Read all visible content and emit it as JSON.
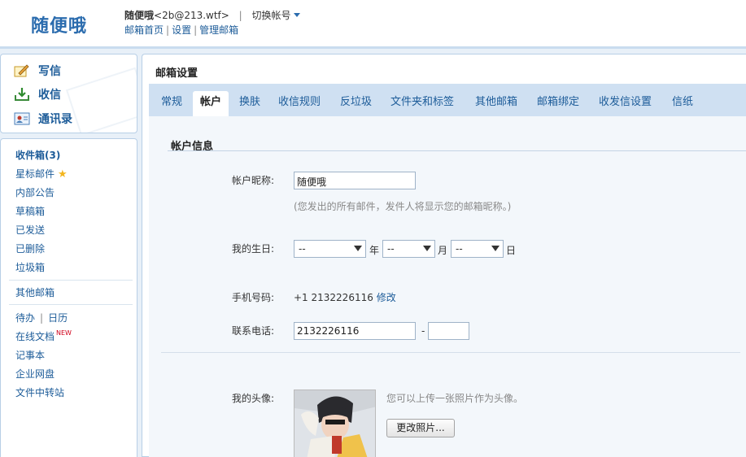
{
  "header": {
    "logo": "随便哦",
    "nickname": "随便哦",
    "email": "<2b@213.wtf>",
    "separator": "|",
    "switch_account": "切换帐号",
    "links": [
      "邮箱首页",
      "设置",
      "管理邮箱"
    ],
    "link_sep": "|"
  },
  "quick_actions": {
    "compose": "写信",
    "receive": "收信",
    "contacts": "通讯录"
  },
  "folders": {
    "inbox": "收件箱(3)",
    "starred": "星标邮件",
    "announcements": "内部公告",
    "drafts": "草稿箱",
    "sent": "已发送",
    "deleted": "已删除",
    "spam": "垃圾箱",
    "other_mailboxes": "其他邮箱",
    "todo": "待办",
    "todo_sep": "|",
    "calendar": "日历",
    "online_docs": "在线文档",
    "new_badge": "NEW",
    "notes": "记事本",
    "netdisk": "企业网盘",
    "file_transfer": "文件中转站"
  },
  "main": {
    "title": "邮箱设置",
    "tabs": [
      "常规",
      "帐户",
      "换肤",
      "收信规则",
      "反垃圾",
      "文件夹和标签",
      "其他邮箱",
      "邮箱绑定",
      "收发信设置",
      "信纸"
    ],
    "active_tab": "帐户"
  },
  "account": {
    "section_title": "帐户信息",
    "nickname_label": "帐户昵称:",
    "nickname_value": "随便哦",
    "nickname_hint": "(您发出的所有邮件，发件人将显示您的邮箱昵称。)",
    "birthday_label": "我的生日:",
    "birthday_year": "--",
    "year_unit": "年",
    "birthday_month": "--",
    "month_unit": "月",
    "birthday_day": "--",
    "day_unit": "日",
    "mobile_label": "手机号码:",
    "mobile_value": "+1 2132226116",
    "mobile_edit": "修改",
    "phone_label": "联系电话:",
    "phone_value": "2132226116",
    "phone_dash": "-",
    "phone_ext": "",
    "avatar_label": "我的头像:",
    "avatar_hint": "您可以上传一张照片作为头像。",
    "change_photo": "更改照片..."
  },
  "colors": {
    "link": "#1d5c99",
    "logo": "#2b6cae",
    "tabbar": "#cfe0f2",
    "content_bg": "#f3f7fb",
    "star": "#f3b51d",
    "new_badge": "#d0021b"
  }
}
